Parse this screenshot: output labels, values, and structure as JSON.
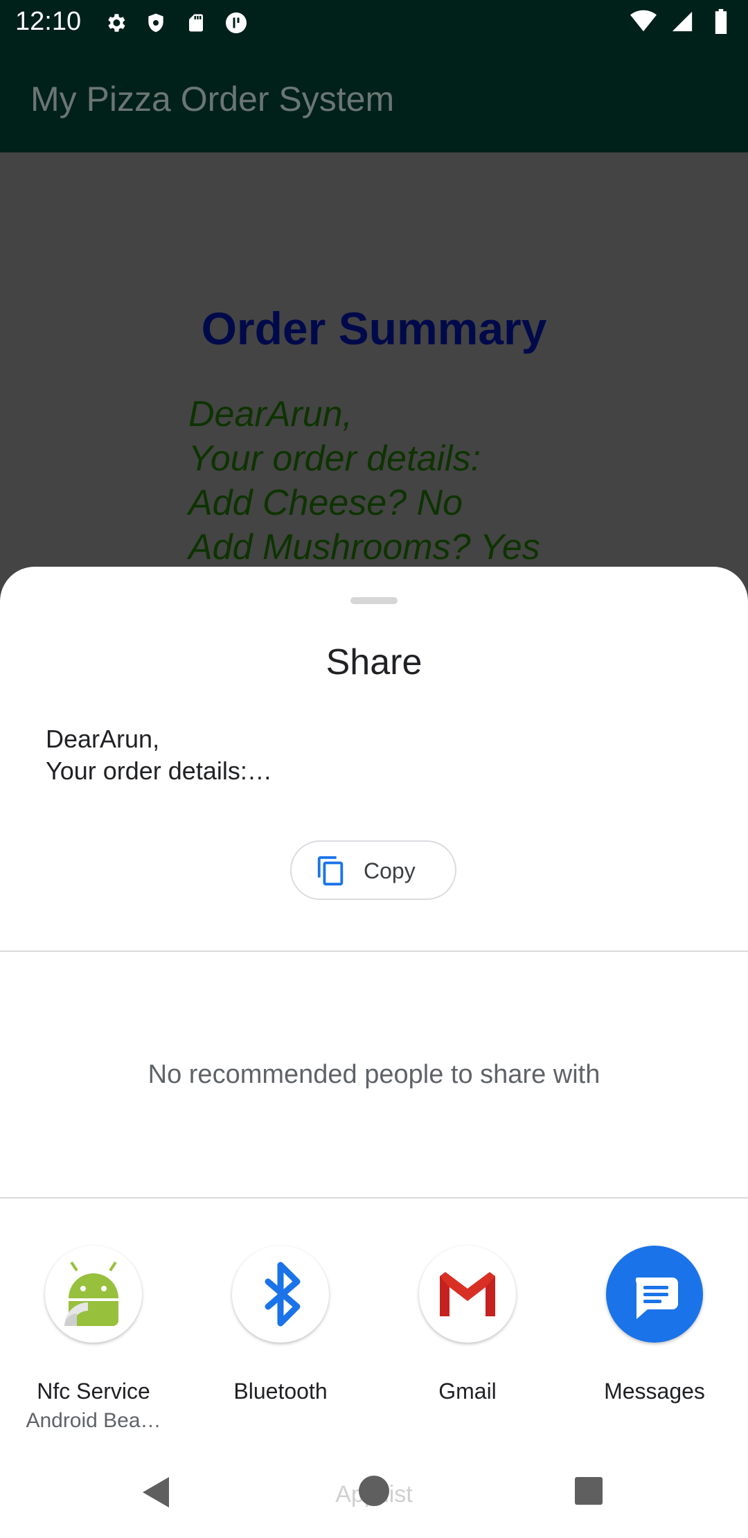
{
  "status_bar": {
    "time": "12:10",
    "left_icons": [
      "settings-icon",
      "shield-icon",
      "sd-card-icon",
      "vpn-key-icon"
    ],
    "right_icons": [
      "wifi-icon",
      "signal-icon",
      "battery-icon"
    ]
  },
  "app_bar": {
    "title": "My Pizza Order System"
  },
  "content": {
    "summary_title": "Order Summary",
    "lines": [
      "DearArun,",
      "Your order details:",
      "Add Cheese? No",
      "Add Mushrooms? Yes"
    ]
  },
  "share_sheet": {
    "title": "Share",
    "preview_lines": [
      "DearArun,",
      "Your order details:…"
    ],
    "copy_label": "Copy",
    "no_people_text": "No recommended people to share with",
    "apps": [
      {
        "label": "Nfc Service",
        "sub": "Android Bea…",
        "icon": "nfc-android-icon"
      },
      {
        "label": "Bluetooth",
        "sub": "",
        "icon": "bluetooth-icon"
      },
      {
        "label": "Gmail",
        "sub": "",
        "icon": "gmail-icon"
      },
      {
        "label": "Messages",
        "sub": "",
        "icon": "messages-icon"
      }
    ]
  },
  "nav_bar": {
    "hint": "App list"
  },
  "colors": {
    "status_bar": "#00201a",
    "accent_blue": "#1a73e8",
    "scrim": "#444444"
  }
}
